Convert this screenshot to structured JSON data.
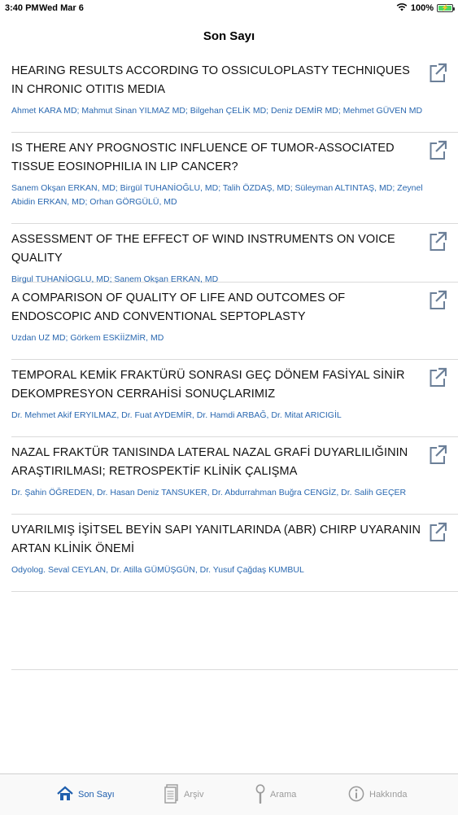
{
  "status": {
    "time": "3:40 PM",
    "date": "Wed Mar 6",
    "battery_pct": "100%",
    "battery_level": 1.0
  },
  "nav": {
    "title": "Son Sayı"
  },
  "articles": [
    {
      "title": "HEARING RESULTS ACCORDING TO OSSICULOPLASTY TECHNIQUES IN CHRONIC OTITIS MEDIA",
      "authors": "Ahmet KARA MD; Mahmut Sinan YILMAZ MD; Bilgehan ÇELİK MD; Deniz DEMİR MD; Mehmet GÜVEN MD"
    },
    {
      "title": "IS THERE ANY PROGNOSTIC INFLUENCE OF TUMOR-ASSOCIATED TISSUE EOSINOPHILIA IN LIP CANCER?",
      "authors": "Sanem Okşan ERKAN, MD; Birgül TUHANİOĞLU, MD; Talih ÖZDAŞ, MD; Süleyman ALTINTAŞ, MD; Zeynel Abidin ERKAN, MD;  Orhan GÖRGÜLÜ, MD"
    },
    {
      "title": "ASSESSMENT OF THE EFFECT OF WIND INSTRUMENTS ON VOICE QUALITY",
      "authors": "Birgul TUHANİOGLU, MD; Sanem Okşan ERKAN, MD"
    },
    {
      "title": "A COMPARISON OF QUALITY OF LIFE AND OUTCOMES OF ENDOSCOPIC AND CONVENTIONAL SEPTOPLASTY",
      "authors": "Uzdan UZ MD; Görkem ESKİİZMİR, MD"
    },
    {
      "title": "TEMPORAL KEMİK FRAKTÜRÜ SONRASI GEÇ DÖNEM FASİYAL SİNİR DEKOMPRESYON CERRAHİSİ SONUÇLARIMIZ",
      "authors": "Dr. Mehmet Akif ERYILMAZ, Dr. Fuat AYDEMİR, Dr. Hamdi ARBAĞ, Dr. Mitat ARICIGİL"
    },
    {
      "title": "NAZAL FRAKTÜR TANISINDA LATERAL NAZAL GRAFİ DUYARLILIĞININ ARAŞTIRILMASI; RETROSPEKTİF KLİNİK ÇALIŞMA",
      "authors": "Dr. Şahin ÖĞREDEN, Dr. Hasan Deniz TANSUKER, Dr. Abdurrahman Buğra CENGİZ, Dr. Salih GEÇER"
    },
    {
      "title": "UYARILMIŞ İŞİTSEL BEYİN SAPI YANITLARINDA (ABR) CHIRP UYARANIN ARTAN KLİNİK ÖNEMİ",
      "authors": "Odyolog. Seval CEYLAN, Dr. Atilla GÜMÜŞGÜN, Dr. Yusuf Çağdaş KUMBUL"
    }
  ],
  "tabs": [
    {
      "label": "Son Sayı",
      "icon": "home-icon",
      "active": true
    },
    {
      "label": "Arşiv",
      "icon": "archive-icon",
      "active": false
    },
    {
      "label": "Arama",
      "icon": "search-icon",
      "active": false
    },
    {
      "label": "Hakkında",
      "icon": "info-icon",
      "active": false
    }
  ],
  "colors": {
    "accent": "#1f5fae",
    "authors": "#2a68b0",
    "tab_inactive": "#9b9b9b"
  }
}
